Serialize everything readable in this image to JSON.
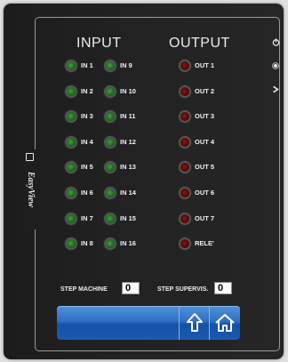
{
  "headers": {
    "input": "INPUT",
    "output": "OUTPUT"
  },
  "inputs_left": [
    "IN 1",
    "IN 2",
    "IN 3",
    "IN 4",
    "IN 5",
    "IN 6",
    "IN 7",
    "IN 8"
  ],
  "inputs_right": [
    "IN 9",
    "IN 10",
    "IN 11",
    "IN 12",
    "IN 13",
    "IN 14",
    "IN 15",
    "IN 16"
  ],
  "outputs": [
    "OUT 1",
    "OUT 2",
    "OUT 3",
    "OUT 4",
    "OUT 5",
    "OUT 6",
    "OUT 7",
    "RELE'"
  ],
  "side_icons": [
    "power-icon",
    "brightness-icon",
    "next-icon"
  ],
  "logo": {
    "text": "EasyView"
  },
  "step_machine": {
    "label": "STEP MACHINE",
    "value": "0"
  },
  "step_supervis": {
    "label": "STEP SUPERVIS.",
    "value": "0"
  },
  "nav": {
    "up": "up-arrow-icon",
    "home": "home-icon"
  },
  "colors": {
    "input_led": "#2e8b2e",
    "output_led": "#6b0f0f",
    "bar": "#2a66bd"
  }
}
